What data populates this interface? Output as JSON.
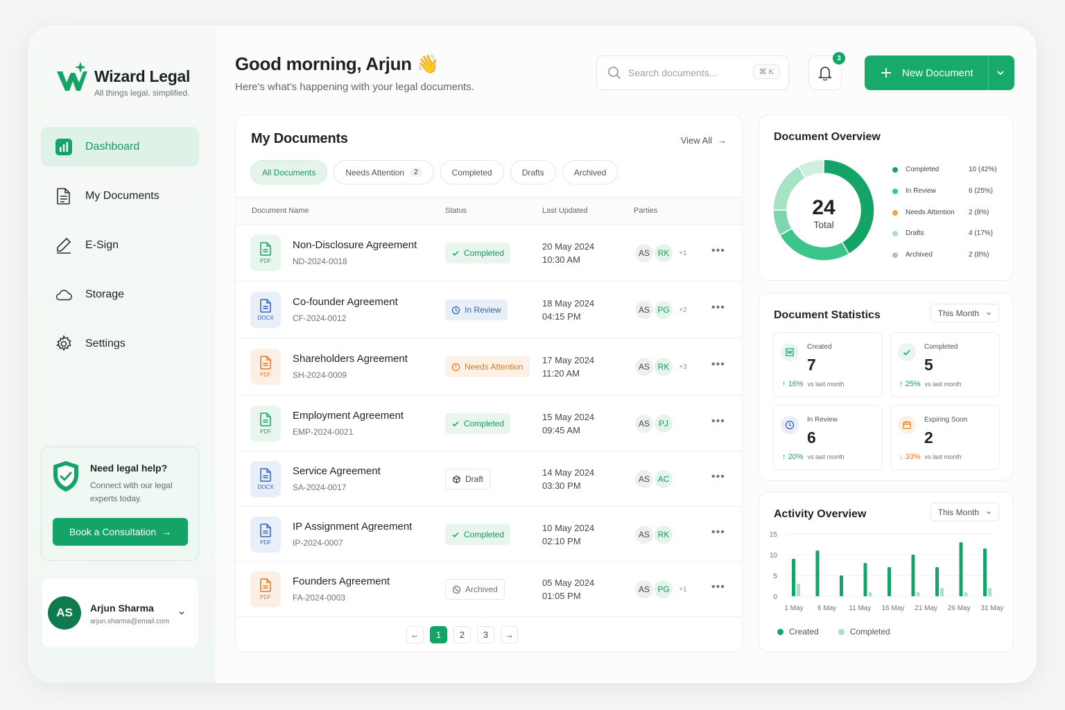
{
  "brand": {
    "name": "Wizard Legal",
    "tagline": "All things legal, simplified.",
    "accent": "#14a467"
  },
  "nav": [
    {
      "label": "Dashboard",
      "icon": "chart-icon",
      "active": true
    },
    {
      "label": "My Documents",
      "icon": "document-icon"
    },
    {
      "label": "E-Sign",
      "icon": "pen-icon"
    },
    {
      "label": "Storage",
      "icon": "cloud-icon"
    },
    {
      "label": "Settings",
      "icon": "gear-icon"
    }
  ],
  "help": {
    "title": "Need legal help?",
    "text": "Connect with our legal experts today.",
    "button": "Book a Consultation"
  },
  "user": {
    "initials": "AS",
    "name": "Arjun Sharma",
    "email": "arjun.sharma@email.com"
  },
  "header": {
    "greeting": "Good morning, Arjun",
    "emoji": "👋",
    "subtitle": "Here's what's happening with your legal documents.",
    "search_placeholder": "Search documents...",
    "search_shortcut": "⌘ K",
    "notifications": "3",
    "new_document": "New Document"
  },
  "documents": {
    "title": "My Documents",
    "view_all": "View All",
    "tabs": [
      {
        "label": "All Documents",
        "active": true
      },
      {
        "label": "Needs Attention",
        "count": "2"
      },
      {
        "label": "Completed"
      },
      {
        "label": "Drafts"
      },
      {
        "label": "Archived"
      }
    ],
    "columns": {
      "name": "Document Name",
      "status": "Status",
      "updated": "Last Updated",
      "parties": "Parties"
    },
    "rows": [
      {
        "name": "Non-Disclosure Agreement",
        "id": "ND-2024-0018",
        "type": "PDF",
        "style": "pdf-g",
        "status": "Completed",
        "st": "completed",
        "date": "20 May 2024",
        "time": "10:30 AM",
        "parties": [
          "AS",
          "RK"
        ],
        "more": "+1"
      },
      {
        "name": "Co-founder Agreement",
        "id": "CF-2024-0012",
        "type": "DOCX",
        "style": "docx",
        "status": "In Review",
        "st": "review",
        "date": "18 May 2024",
        "time": "04:15 PM",
        "parties": [
          "AS",
          "PG"
        ],
        "more": "+2"
      },
      {
        "name": "Shareholders Agreement",
        "id": "SH-2024-0009",
        "type": "PDF",
        "style": "pdf-o",
        "status": "Needs Attention",
        "st": "attention",
        "date": "17 May 2024",
        "time": "11:20 AM",
        "parties": [
          "AS",
          "RK"
        ],
        "more": "+3"
      },
      {
        "name": "Employment Agreement",
        "id": "EMP-2024-0021",
        "type": "PDF",
        "style": "pdf-g",
        "status": "Completed",
        "st": "completed",
        "date": "15 May 2024",
        "time": "09:45 AM",
        "parties": [
          "AS",
          "PJ"
        ],
        "more": ""
      },
      {
        "name": "Service Agreement",
        "id": "SA-2024-0017",
        "type": "DOCX",
        "style": "docx",
        "status": "Draft",
        "st": "draft",
        "date": "14 May 2024",
        "time": "03:30 PM",
        "parties": [
          "AS",
          "AC"
        ],
        "more": ""
      },
      {
        "name": "IP Assignment Agreement",
        "id": "IP-2024-0007",
        "type": "PDF",
        "style": "docx",
        "status": "Completed",
        "st": "completed",
        "date": "10 May 2024",
        "time": "02:10 PM",
        "parties": [
          "AS",
          "RK"
        ],
        "more": ""
      },
      {
        "name": "Founders Agreement",
        "id": "FA-2024-0003",
        "type": "PDF",
        "style": "pdf-o",
        "status": "Archived",
        "st": "archived",
        "date": "05 May 2024",
        "time": "01:05 PM",
        "parties": [
          "AS",
          "PG"
        ],
        "more": "+1"
      }
    ],
    "pages": [
      "1",
      "2",
      "3"
    ],
    "current_page": "1"
  },
  "overview": {
    "title": "Document Overview",
    "total": "24",
    "total_label": "Total",
    "items": [
      {
        "label": "Completed",
        "value": "10 (42%)",
        "count": 10,
        "color": "#14a467"
      },
      {
        "label": "In Review",
        "value": "6 (25%)",
        "count": 6,
        "color": "#3cc58a"
      },
      {
        "label": "Needs Attention",
        "value": "2 (8%)",
        "count": 2,
        "color": "#f2a541"
      },
      {
        "label": "Drafts",
        "value": "4 (17%)",
        "count": 4,
        "color": "#a6e3c4"
      },
      {
        "label": "Archived",
        "value": "2 (8%)",
        "count": 2,
        "color": "#b9bfbc"
      }
    ],
    "ring_colors": [
      "#14a467",
      "#3cc58a",
      "#7dd6ad",
      "#a6e3c4",
      "#cfeedd"
    ]
  },
  "statistics": {
    "title": "Document Statistics",
    "period": "This Month",
    "cards": [
      {
        "label": "Created",
        "value": "7",
        "change": "16%",
        "dir": "up",
        "compare": "vs last month",
        "icon": "created-icon"
      },
      {
        "label": "Completed",
        "value": "5",
        "change": "25%",
        "dir": "up",
        "compare": "vs last month",
        "icon": "check-icon"
      },
      {
        "label": "In Review",
        "value": "6",
        "change": "20%",
        "dir": "up",
        "compare": "vs last month",
        "icon": "clock-icon"
      },
      {
        "label": "Expiring Soon",
        "value": "2",
        "change": "33%",
        "dir": "down",
        "compare": "vs last month",
        "icon": "calendar-icon"
      }
    ]
  },
  "activity": {
    "title": "Activity Overview",
    "period": "This Month",
    "legend": [
      "Created",
      "Completed"
    ],
    "colors": {
      "created": "#14a467",
      "completed": "#a6e3c4"
    }
  },
  "chart_data": {
    "type": "bar",
    "x_labels": [
      "1 May",
      "6 May",
      "11 May",
      "16 May",
      "21 May",
      "26 May",
      "31 May"
    ],
    "ylim": [
      0,
      15
    ],
    "yticks": [
      0,
      5,
      10,
      15
    ],
    "series": [
      {
        "name": "Created",
        "values": [
          9,
          11,
          5,
          8,
          7,
          10,
          7,
          13,
          11.5
        ]
      },
      {
        "name": "Completed",
        "values": [
          3,
          0,
          0,
          1,
          0,
          1,
          2,
          1,
          2
        ]
      }
    ]
  }
}
